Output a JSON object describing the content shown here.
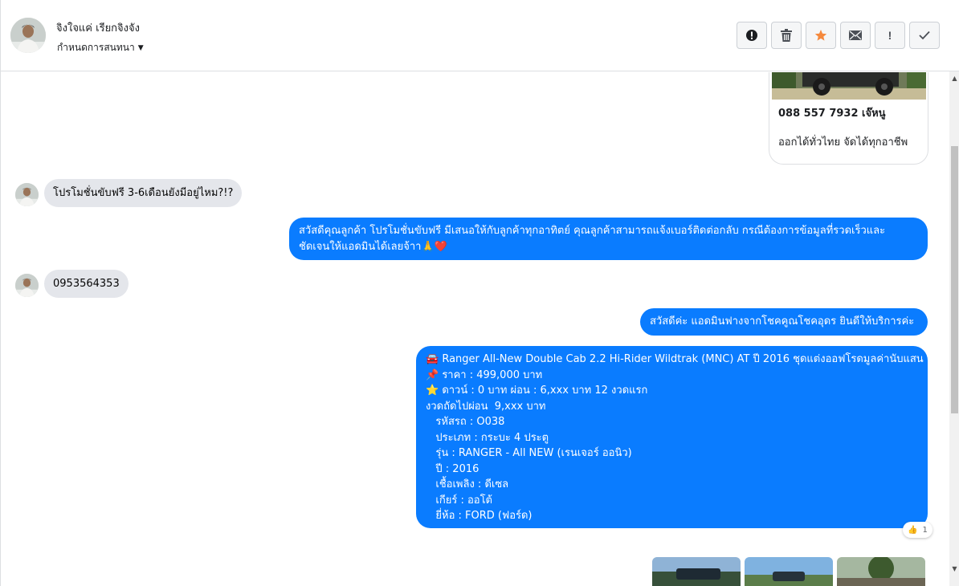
{
  "header": {
    "contact_name": "จิงใจแค่ เรียกจิงจัง",
    "assign_label": "กำหนดการสนทนา",
    "toolbar": [
      {
        "name": "report-button",
        "icon": "alert-circle-icon"
      },
      {
        "name": "delete-button",
        "icon": "trash-icon"
      },
      {
        "name": "star-button",
        "icon": "star-icon"
      },
      {
        "name": "mail-button",
        "icon": "envelope-icon"
      },
      {
        "name": "important-button",
        "icon": "exclamation-icon"
      },
      {
        "name": "done-button",
        "icon": "check-icon"
      }
    ],
    "important_glyph": "!"
  },
  "card": {
    "title": "088 557 7932 เจ๊หนู",
    "description": "ออกได้ทั่วไทย จัดได้ทุกอาชีพ"
  },
  "messages": {
    "in1": "โปรโมชั่นขับฟรี 3-6เดือนยังมีอยู่ไหม?!?",
    "out1_line1": "สวัสดีคุณลูกค้า โปรโมชั่นขับฟรี มีเสนอให้กับลูกค้าทุกอาทิตย์ คุณลูกค้าสามารถแจ้งเบอร์ติดต่อกลับ กรณีต้องการข้อมูลที่รวดเร็วและ",
    "out1_line2": "ชัดเจนให้แอดมินได้เลยจ้าา🙏❤️",
    "in2": "0953564353",
    "out2": "สวัสดีค่ะ แอดมินฟางจากโชคคูณโชคอุดร ยินดีให้บริการค่ะ",
    "out3": [
      "🚘 Ranger All-New Double Cab 2.2 Hi-Rider Wildtrak (MNC) AT ปี 2016 ชุดแต่งออฟโรดมูลค่านับแสน",
      "📌 ราคา : 499,000 บาท",
      "⭐ ดาวน์ : 0 บาท ผ่อน : 6,xxx บาท 12 งวดแรก",
      "งวดถัดไปผ่อน  9,xxx บาท",
      "   รหัสรถ : O038",
      "   ประเภท : กระบะ 4 ประตู",
      "   รุ่น : RANGER - All NEW (เรนเจอร์ ออนิว)",
      "   ปี : 2016",
      "   เชื้อเพลิง : ดีเซล",
      "   เกียร์ : ออโต้",
      "   ยี่ห้อ : FORD (ฟอร์ด)"
    ],
    "reaction_emoji": "👍",
    "reaction_count": "1"
  },
  "colors": {
    "outgoing_bubble": "#0a7cff",
    "incoming_bubble": "#e4e6eb",
    "star": "#f5893d"
  }
}
